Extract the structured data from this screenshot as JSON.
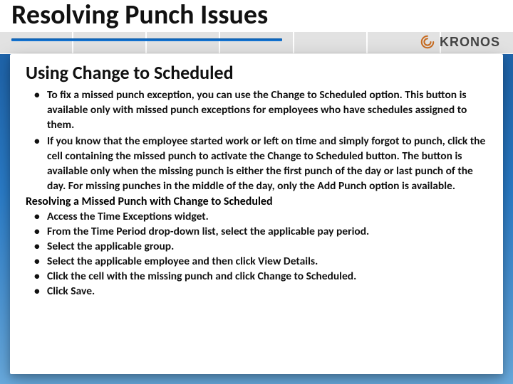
{
  "brand": {
    "name": "KRONOS"
  },
  "slide": {
    "title": "Resolving Punch Issues",
    "section_title": "Using Change to Scheduled",
    "intro_bullets": [
      "To fix a missed punch exception, you can use the Change to Scheduled option. This button is available only with missed punch exceptions for employees who have schedules assigned to them.",
      "If you know that the employee started work or left on time and simply forgot to punch, click the cell containing the missed punch to activate the Change to Scheduled button. The button is available only when the missing punch is either the first punch of the day or last punch of the day. For missing punches in the middle of the day, only the Add Punch option is available."
    ],
    "sub_heading": "Resolving a Missed Punch with Change to Scheduled",
    "step_bullets": [
      "Access the Time Exceptions widget.",
      "From the Time Period drop-down list, select the applicable pay period.",
      "Select the applicable group.",
      "Select the applicable employee and then click View Details.",
      "Click the cell with the missing punch and click Change to Scheduled.",
      "Click Save."
    ]
  }
}
